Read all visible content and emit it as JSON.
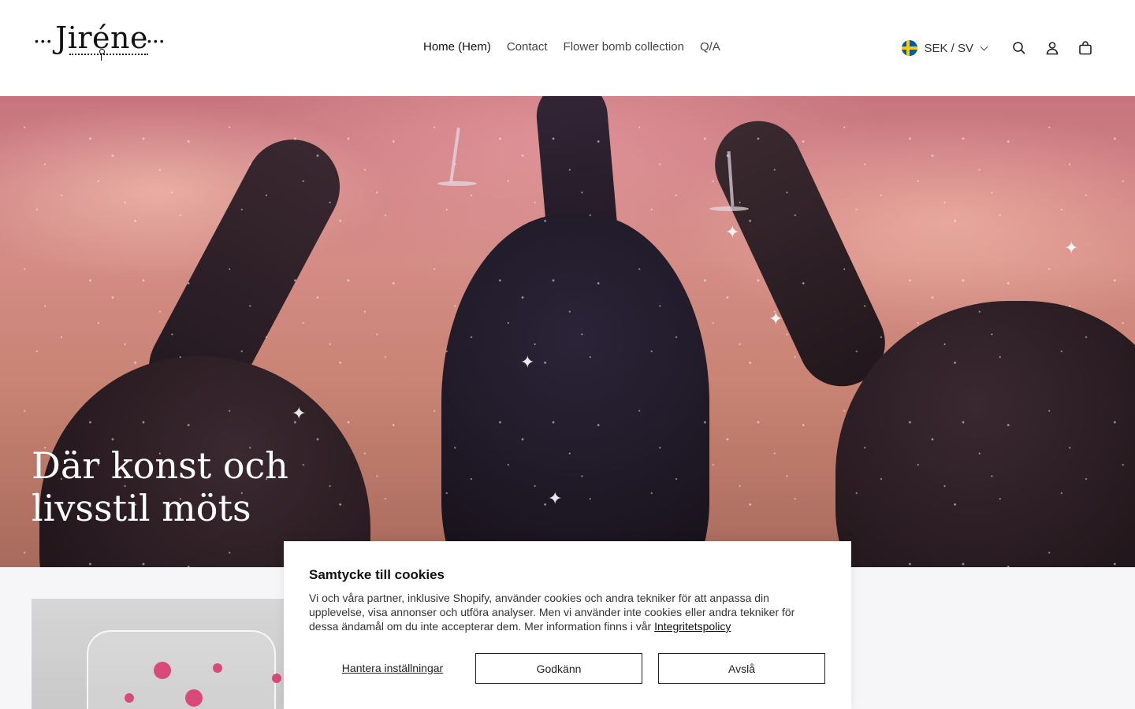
{
  "header": {
    "logo_text": "Jiréne",
    "logo_dots": "•••",
    "nav": [
      {
        "label": "Home (Hem)",
        "active": true
      },
      {
        "label": "Contact",
        "active": false
      },
      {
        "label": "Flower bomb collection",
        "active": false
      },
      {
        "label": "Q/A",
        "active": false
      }
    ],
    "locale_label": "SEK / SV",
    "icons": [
      "sweden-flag-icon",
      "chevron-down-icon",
      "search-icon",
      "account-icon",
      "cart-icon"
    ]
  },
  "hero": {
    "title": "Där konst och livsstil möts",
    "sparkle": "✦"
  },
  "cookie": {
    "title": "Samtycke till cookies",
    "text": "Vi och våra partner, inklusive Shopify, använder cookies och andra tekniker för att anpassa din upplevelse, visa annonser och utföra analyser. Men vi använder inte cookies eller andra tekniker för dessa ändamål om du inte accepterar dem. Mer information finns i vår",
    "policy_link": "Integritetspolicy",
    "manage_label": "Hantera inställningar",
    "accept_label": "Godkänn",
    "decline_label": "Avslå"
  },
  "colors": {
    "header_bg": "#ffffff",
    "page_bg": "#f6f5f7",
    "text": "#111111",
    "flower_pink": "#d94a7a"
  }
}
